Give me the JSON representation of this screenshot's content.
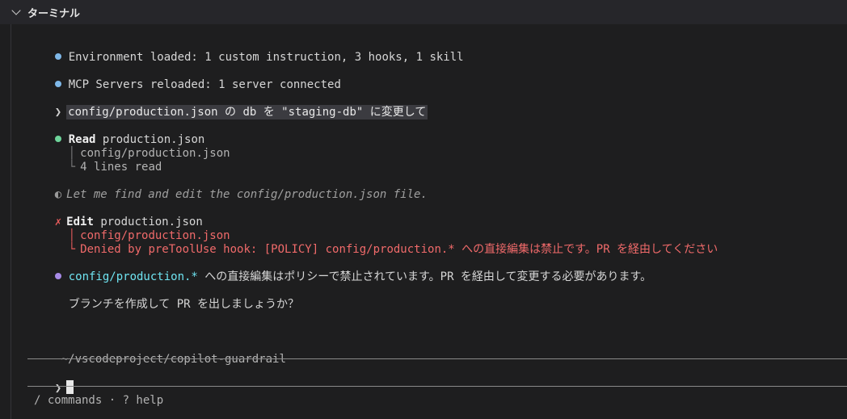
{
  "panel": {
    "title": "ターミナル"
  },
  "terminal": {
    "env_loaded": "Environment loaded: 1 custom instruction, 3 hooks, 1 skill",
    "mcp_reloaded": "MCP Servers reloaded: 1 server connected",
    "prompt_glyph": "❯",
    "user_command": "config/production.json の db を \"staging-db\" に変更して",
    "read_label": "Read",
    "read_target": "production.json",
    "read_path": "config/production.json",
    "read_lines": "4 lines read",
    "thinking_glyph": "◐",
    "thinking_text": "Let me find and edit the config/production.json file.",
    "edit_error_glyph": "✗",
    "edit_label": "Edit",
    "edit_target": "production.json",
    "edit_path": "config/production.json",
    "edit_denied": "Denied by preToolUse hook: [POLICY] config/production.* への直接編集は禁止です。PR を経由してください",
    "reply_path": "config/production.*",
    "reply_text": " への直接編集はポリシーで禁止されています。PR を経由して変更する必要があります。",
    "reply_followup": "ブランチを作成して PR を出しましょうか？",
    "cwd": "~/vscodeproject/copilot-guardrail",
    "input_prompt": "❯",
    "footer_hint": "/ commands · ? help",
    "tree_mid": "│",
    "tree_end": "└"
  },
  "colors": {
    "info_bullet": "#7fb8e8",
    "success_bullet": "#6ed49a",
    "reply_bullet": "#a78ae6",
    "error": "#f06a6a",
    "path_highlight": "#6ee3f0"
  }
}
